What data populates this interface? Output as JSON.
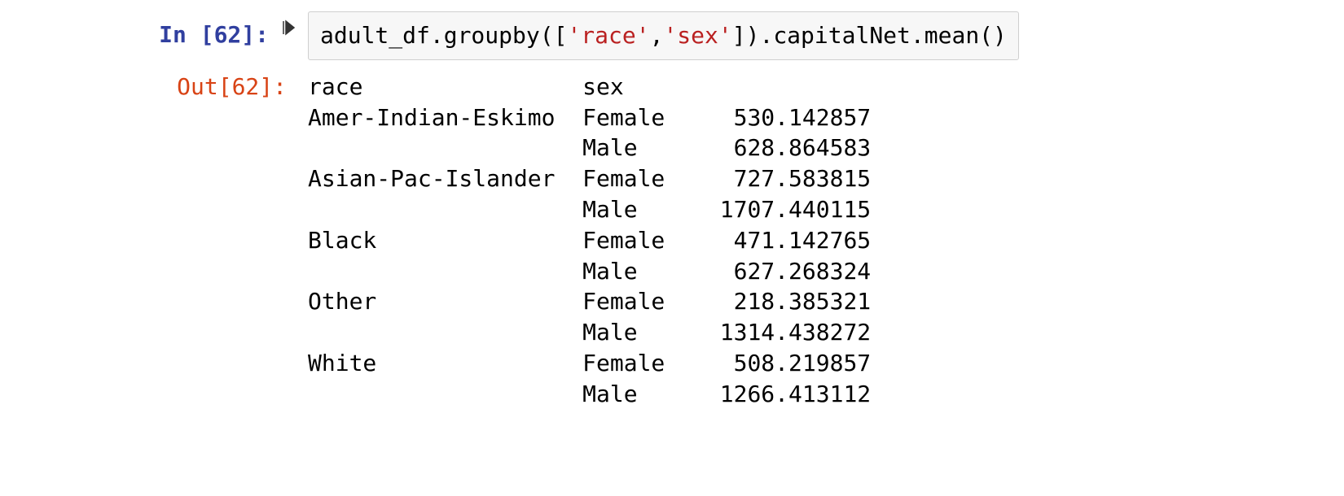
{
  "input": {
    "prompt": "In [62]:",
    "code_plain": "adult_df.groupby([",
    "code_str1": "'race'",
    "code_comma": ",",
    "code_str2": "'sex'",
    "code_tail": "]).capitalNet.mean()"
  },
  "output": {
    "prompt": "Out[62]:",
    "header_race": "race",
    "header_sex": "sex",
    "rows": [
      {
        "race": "Amer-Indian-Eskimo",
        "sex": "Female",
        "value": "530.142857"
      },
      {
        "race": "",
        "sex": "Male",
        "value": "628.864583"
      },
      {
        "race": "Asian-Pac-Islander",
        "sex": "Female",
        "value": "727.583815"
      },
      {
        "race": "",
        "sex": "Male",
        "value": "1707.440115"
      },
      {
        "race": "Black",
        "sex": "Female",
        "value": "471.142765"
      },
      {
        "race": "",
        "sex": "Male",
        "value": "627.268324"
      },
      {
        "race": "Other",
        "sex": "Female",
        "value": "218.385321"
      },
      {
        "race": "",
        "sex": "Male",
        "value": "1314.438272"
      },
      {
        "race": "White",
        "sex": "Female",
        "value": "508.219857"
      },
      {
        "race": "",
        "sex": "Male",
        "value": "1266.413112"
      }
    ]
  },
  "layout": {
    "race_width": 20,
    "sex_width": 8,
    "val_width": 13
  }
}
